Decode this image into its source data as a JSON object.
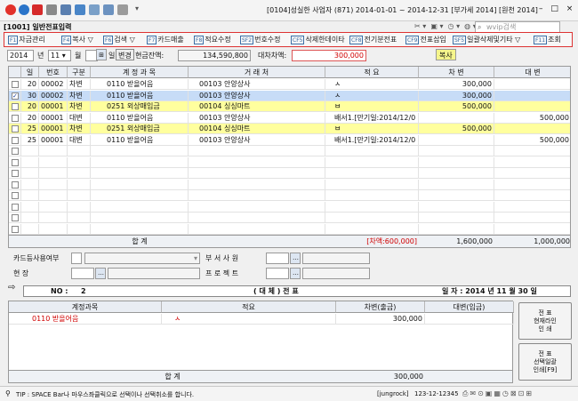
{
  "window": {
    "title": "[0104]성실한 사업자 (871) 2014-01-01 ~ 2014-12-31 [부가세 2014] [원천 2014]",
    "screen_title": "[1001] 일반전표입력",
    "search_placeholder": "wvip검색",
    "controls": [
      "–",
      "□",
      "×"
    ]
  },
  "function_bar": [
    {
      "key": "F1",
      "label": "자금관리"
    },
    {
      "key": "F4",
      "label": "복사"
    },
    {
      "key": "F6",
      "label": "검색"
    },
    {
      "key": "F7",
      "label": "카드매출"
    },
    {
      "key": "F8",
      "label": "적요수정"
    },
    {
      "key": "SF2",
      "label": "번호수정"
    },
    {
      "key": "CF5",
      "label": "삭제한데이타"
    },
    {
      "key": "CF8",
      "label": "전기분전표"
    },
    {
      "key": "CF9",
      "label": "전표삽입"
    },
    {
      "key": "SF5",
      "label": "일괄삭제및기타"
    },
    {
      "key": "F11",
      "label": "조회"
    }
  ],
  "header": {
    "year": "2014",
    "year_unit": "년",
    "month": "11",
    "month_unit": "월",
    "day_unit": "일",
    "change_btn": "변경",
    "cash_balance_label": "현금잔액:",
    "cash_balance": "134,590,800",
    "diff_label": "대차차액:",
    "diff_value": "300,000",
    "copy_btn": "복사"
  },
  "grid": {
    "columns": [
      "일",
      "번호",
      "구분",
      "계 정 과 목",
      "거 래 처",
      "적 요",
      "차 변",
      "대 변"
    ],
    "rows": [
      {
        "day": "20",
        "no": "00002",
        "type": "차변",
        "acct_code": "0110",
        "acct": "받을어음",
        "cust_code": "00103",
        "cust": "안양상사",
        "memo": "ㅅ",
        "debit": "300,000",
        "credit": "",
        "style": "normal",
        "checked": false
      },
      {
        "day": "30",
        "no": "00002",
        "type": "차변",
        "acct_code": "0110",
        "acct": "받을어음",
        "cust_code": "00103",
        "cust": "안양상사",
        "memo": "ㅅ",
        "debit": "300,000",
        "credit": "",
        "style": "selected",
        "checked": true
      },
      {
        "day": "20",
        "no": "00001",
        "type": "차변",
        "acct_code": "0251",
        "acct": "외상매입금",
        "cust_code": "00104",
        "cust": "싱싱마트",
        "memo": "ㅂ",
        "debit": "500,000",
        "credit": "",
        "style": "yellow",
        "checked": false
      },
      {
        "day": "20",
        "no": "00001",
        "type": "대변",
        "acct_code": "0110",
        "acct": "받을어음",
        "cust_code": "00103",
        "cust": "안양상사",
        "memo": "배서1.[만기일:2014/12/0",
        "debit": "",
        "credit": "500,000",
        "style": "normal",
        "checked": false
      },
      {
        "day": "25",
        "no": "00001",
        "type": "차변",
        "acct_code": "0251",
        "acct": "외상매입금",
        "cust_code": "00104",
        "cust": "싱싱마트",
        "memo": "ㅂ",
        "debit": "500,000",
        "credit": "",
        "style": "yellow",
        "checked": false
      },
      {
        "day": "25",
        "no": "00001",
        "type": "대변",
        "acct_code": "0110",
        "acct": "받을어음",
        "cust_code": "00103",
        "cust": "안양상사",
        "memo": "배서1.[만기일:2014/12/0",
        "debit": "",
        "credit": "500,000",
        "style": "normal",
        "checked": false
      }
    ],
    "sum_label": "합          계",
    "sum_diff": "[차액:600,000]",
    "sum_debit": "1,600,000",
    "sum_credit": "1,000,000"
  },
  "detail_form": {
    "card_label": "카드등사용여부",
    "site_label": "현          장",
    "dept_label": "부 서 사 원",
    "project_label": "프 로 젝 트"
  },
  "slip": {
    "no_label": "NO :",
    "no_value": "2",
    "type": "( 대 체 )  전  표",
    "date": "일 자 : 2014 년 11 월 30 일"
  },
  "slip_grid": {
    "columns": [
      "계정과목",
      "적요",
      "차변(출금)",
      "대변(입금)"
    ],
    "rows": [
      {
        "acct_code": "0110",
        "acct": "받을어음",
        "memo": "ㅅ",
        "debit": "300,000",
        "credit": ""
      }
    ],
    "sum_label": "합          계",
    "sum_debit": "300,000",
    "sum_credit": ""
  },
  "print_buttons": [
    {
      "label": "전 표\n현재라인\n인 쇄"
    },
    {
      "label": "전 표\n선택일괄\n인쇄[F9]"
    }
  ],
  "status": {
    "tip": "TIP : SPACE Bar나 마우스좌클릭으로 선택이나 선택취소를 합니다.",
    "user": "[jungrock]",
    "phone": "123-12-12345"
  },
  "colors": {
    "selected_row": "#c7dcf7",
    "yellow_row": "#ffff9e",
    "red_text": "#d00000",
    "blue_text": "#1a3f9c",
    "accent_border": "#d33333"
  }
}
